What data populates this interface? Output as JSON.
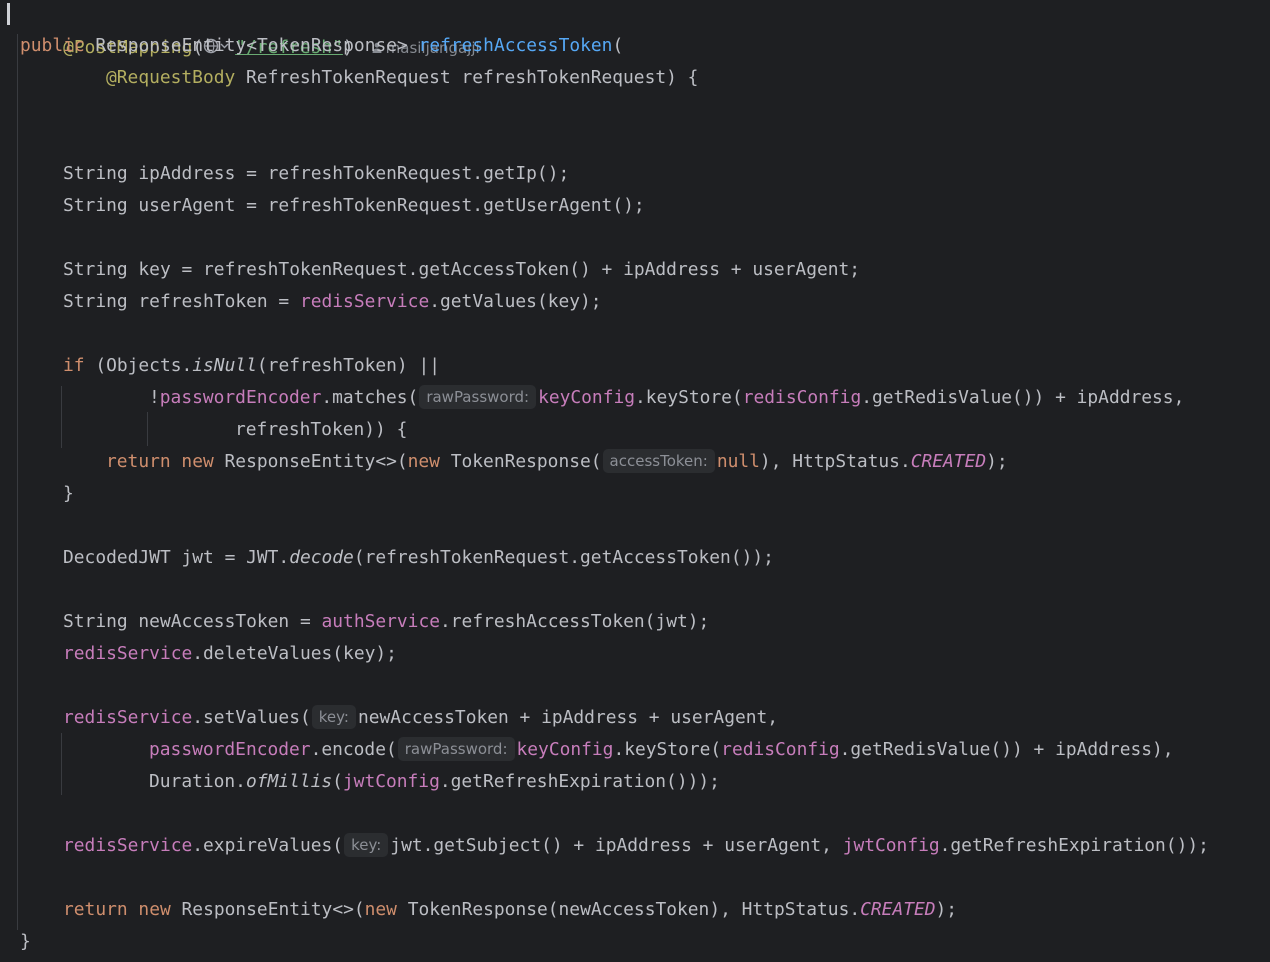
{
  "editor": {
    "annotation": {
      "name": "@PostMapping",
      "open_paren": "(",
      "path": "\"/refresh\"",
      "close_paren": ")",
      "author": "masiljangajji",
      "globe_icon": "globe-icon",
      "chevron_icon": "chevron-down-icon"
    },
    "lines": {
      "l2": {
        "kw": "public",
        "type": " ResponseEntity<TokenResponse> ",
        "method": "refreshAccessToken",
        "rest": "("
      },
      "l3": {
        "ann": "@RequestBody",
        "rest": " RefreshTokenRequest refreshTokenRequest) {"
      },
      "l6": {
        "text": "String ipAddress = refreshTokenRequest.getIp();"
      },
      "l7": {
        "text": "String userAgent = refreshTokenRequest.getUserAgent();"
      },
      "l9": {
        "text": "String key = refreshTokenRequest.getAccessToken() + ipAddress + userAgent;"
      },
      "l10": {
        "a": "String refreshToken = ",
        "field": "redisService",
        "b": ".getValues(key);"
      },
      "l12": {
        "kw": "if",
        "a": " (Objects.",
        "static": "isNull",
        "b": "(refreshToken) ||"
      },
      "l13": {
        "a": "!",
        "field": "passwordEncoder",
        "b": ".matches(",
        "hint": "rawPassword:",
        "field2": "keyConfig",
        "c": ".keyStore(",
        "field3": "redisConfig",
        "d": ".getRedisValue()) + ipAddress,"
      },
      "l14": {
        "text": "refreshToken)) {"
      },
      "l15": {
        "kw": "return",
        "kw2": "new",
        "a": " ResponseEntity<>(",
        "kw3": "new",
        "b": " TokenResponse(",
        "hint": "accessToken:",
        "kw4": "null",
        "c": "), HttpStatus.",
        "const": "CREATED",
        "d": ");"
      },
      "l16": {
        "text": "}"
      },
      "l18": {
        "a": "DecodedJWT jwt = JWT.",
        "static": "decode",
        "b": "(refreshTokenRequest.getAccessToken());"
      },
      "l20": {
        "a": "String newAccessToken = ",
        "field": "authService",
        "b": ".refreshAccessToken(jwt);"
      },
      "l21": {
        "field": "redisService",
        "b": ".deleteValues(key);"
      },
      "l23": {
        "field": "redisService",
        "a": ".setValues(",
        "hint": "key:",
        "b": "newAccessToken + ipAddress + userAgent,"
      },
      "l24": {
        "field": "passwordEncoder",
        "a": ".encode(",
        "hint": "rawPassword:",
        "field2": "keyConfig",
        "b": ".keyStore(",
        "field3": "redisConfig",
        "c": ".getRedisValue()) + ipAddress),"
      },
      "l25": {
        "a": "Duration.",
        "static": "ofMillis",
        "b": "(",
        "field": "jwtConfig",
        "c": ".getRefreshExpiration()));"
      },
      "l27": {
        "field": "redisService",
        "a": ".expireValues(",
        "hint": "key:",
        "b": "jwt.getSubject() + ipAddress + userAgent, ",
        "field2": "jwtConfig",
        "c": ".getRefreshExpiration());"
      },
      "l29": {
        "kw": "return",
        "kw2": "new",
        "a": " ResponseEntity<>(",
        "kw3": "new",
        "b": " TokenResponse(newAccessToken), HttpStatus.",
        "const": "CREATED",
        "c": ");"
      },
      "l30": {
        "text": "}"
      }
    },
    "colors": {
      "background": "#1e1f22",
      "keyword": "#cf8e6d",
      "annotation": "#b3ae60",
      "method_declaration": "#56a8f5",
      "field": "#c77dbb",
      "string": "#6aab73",
      "plain": "#bcbec4"
    }
  }
}
